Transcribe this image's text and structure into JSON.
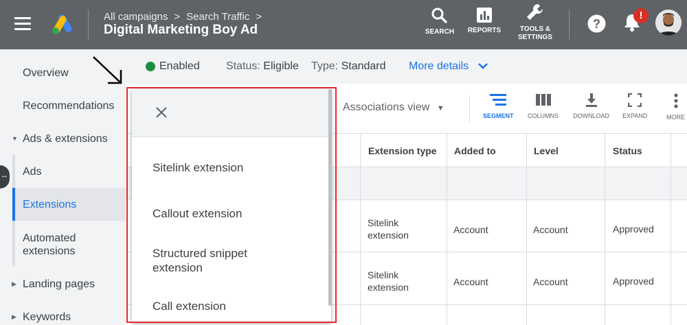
{
  "header": {
    "breadcrumb_1": "All campaigns",
    "breadcrumb_2": "Search Traffic",
    "account_title": "Digital Marketing Boy Ad",
    "tools": {
      "search": "SEARCH",
      "reports": "REPORTS",
      "tools_line1": "TOOLS &",
      "tools_line2": "SETTINGS"
    },
    "notification_count": "!"
  },
  "sidebar": {
    "items": [
      {
        "label": "Overview"
      },
      {
        "label": "Recommendations"
      },
      {
        "label": "Ads & extensions"
      },
      {
        "label": "Ads"
      },
      {
        "label": "Extensions"
      },
      {
        "label": "Automated extensions"
      },
      {
        "label": "Landing pages"
      },
      {
        "label": "Keywords"
      }
    ]
  },
  "status": {
    "enabled": "Enabled",
    "status_label": "Status:",
    "status_value": "Eligible",
    "type_label": "Type:",
    "type_value": "Standard",
    "more_details": "More details"
  },
  "toolbar": {
    "associations_view": "Associations view",
    "segment": "SEGMENT",
    "columns": "COLUMNS",
    "download": "DOWNLOAD",
    "expand": "EXPAND",
    "more": "MORE"
  },
  "table": {
    "headers": [
      "Extension type",
      "Added to",
      "Level",
      "Status"
    ],
    "rows": [
      {
        "ext_line1": "Sitelink",
        "ext_line2": "extension",
        "added_to": "Account",
        "level": "Account",
        "status": "Approved"
      },
      {
        "ext_line1": "Sitelink",
        "ext_line2": "extension",
        "added_to": "Account",
        "level": "Account",
        "status": "Approved"
      }
    ]
  },
  "dropdown": {
    "items": [
      {
        "line1": "Sitelink extension",
        "line2": ""
      },
      {
        "line1": "Callout extension",
        "line2": ""
      },
      {
        "line1": "Structured snippet",
        "line2": "extension"
      },
      {
        "line1": "Call extension",
        "line2": ""
      }
    ]
  },
  "colors": {
    "topbar": "#5f6368",
    "accent": "#1a73e8",
    "enabled_green": "#1e8e3e",
    "highlight_red": "#e8262b",
    "badge_red": "#d93025"
  }
}
